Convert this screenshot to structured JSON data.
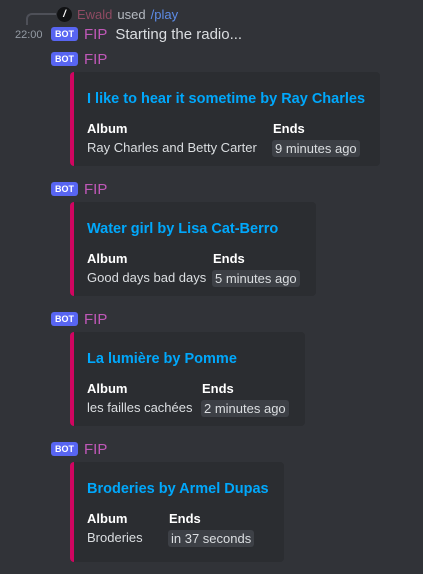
{
  "reply": {
    "avatar_glyph": "/",
    "user": "Ewald",
    "used": "used",
    "command": "/play"
  },
  "first_message": {
    "timestamp": "22:00",
    "bot_tag": "BOT",
    "author": "FIP",
    "text": "Starting the radio..."
  },
  "messages": [
    {
      "bot_tag": "BOT",
      "author": "FIP",
      "embed": {
        "title": "I like to hear it sometime by Ray Charles",
        "album_label": "Album",
        "album_value": "Ray Charles and Betty Carter",
        "ends_label": "Ends",
        "ends_value": "9 minutes ago"
      }
    },
    {
      "bot_tag": "BOT",
      "author": "FIP",
      "embed": {
        "title": "Water girl by Lisa Cat-Berro",
        "album_label": "Album",
        "album_value": "Good days bad days",
        "ends_label": "Ends",
        "ends_value": "5 minutes ago"
      }
    },
    {
      "bot_tag": "BOT",
      "author": "FIP",
      "embed": {
        "title": "La lumière by Pomme",
        "album_label": "Album",
        "album_value": "les failles cachées",
        "ends_label": "Ends",
        "ends_value": "2 minutes ago"
      }
    },
    {
      "bot_tag": "BOT",
      "author": "FIP",
      "embed": {
        "title": "Broderies by Armel Dupas",
        "album_label": "Album",
        "album_value": "Broderies",
        "ends_label": "Ends",
        "ends_value": "in 37 seconds"
      }
    }
  ],
  "colors": {
    "background": "#313338",
    "embed_background": "#2b2d31",
    "embed_accent": "#d00560",
    "link": "#00a8fc",
    "author": "#c058b8",
    "bot_tag": "#5865f2"
  }
}
